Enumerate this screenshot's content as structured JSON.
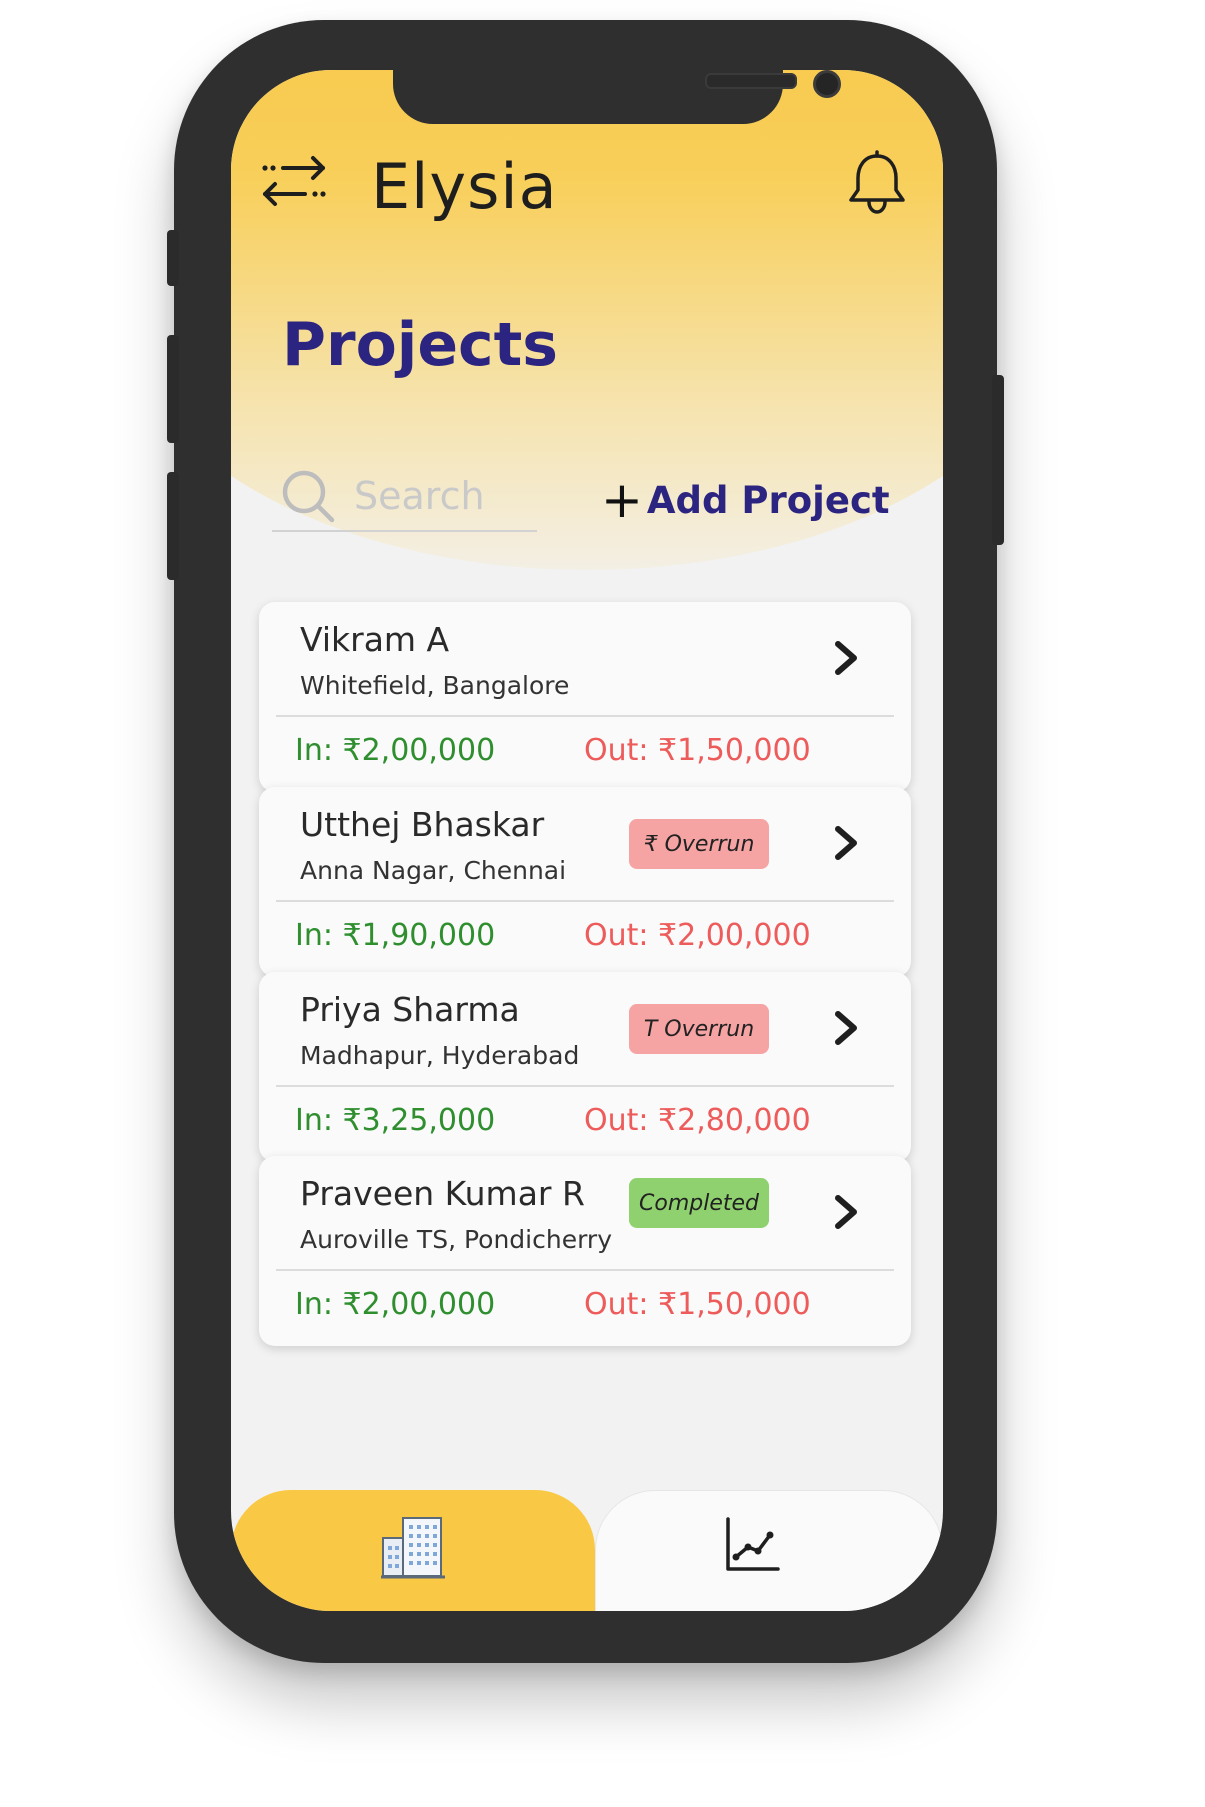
{
  "header": {
    "app_title": "Elysia",
    "page_title": "Projects"
  },
  "search": {
    "placeholder": "Search",
    "value": ""
  },
  "actions": {
    "add_project_label": "Add Project"
  },
  "projects": [
    {
      "name": "Vikram A",
      "location": "Whitefield, Bangalore",
      "in": "In: ₹2,00,000",
      "out": "Out: ₹1,50,000",
      "badge": ""
    },
    {
      "name": "Utthej Bhaskar",
      "location": "Anna Nagar, Chennai",
      "in": "In: ₹1,90,000",
      "out": "Out: ₹2,00,000",
      "badge": "₹ Overrun"
    },
    {
      "name": "Priya Sharma",
      "location": "Madhapur, Hyderabad",
      "in": "In: ₹3,25,000",
      "out": "Out: ₹2,80,000",
      "badge": "T Overrun"
    },
    {
      "name": "Praveen Kumar R",
      "location": "Auroville TS, Pondicherry",
      "in": "In: ₹2,00,000",
      "out": "Out: ₹1,50,000",
      "badge": "Completed"
    }
  ],
  "bottom_nav": {
    "active": "projects",
    "items": [
      "building-icon",
      "chart-icon"
    ]
  },
  "colors": {
    "accent_yellow": "#f9c844",
    "title_navy": "#2b2480",
    "income_green": "#2f8f2f",
    "expense_red": "#ee5b5b",
    "overrun_badge": "#f5a3a3",
    "completed_badge": "#8fd16f",
    "device_frame": "#2f2f2f"
  }
}
